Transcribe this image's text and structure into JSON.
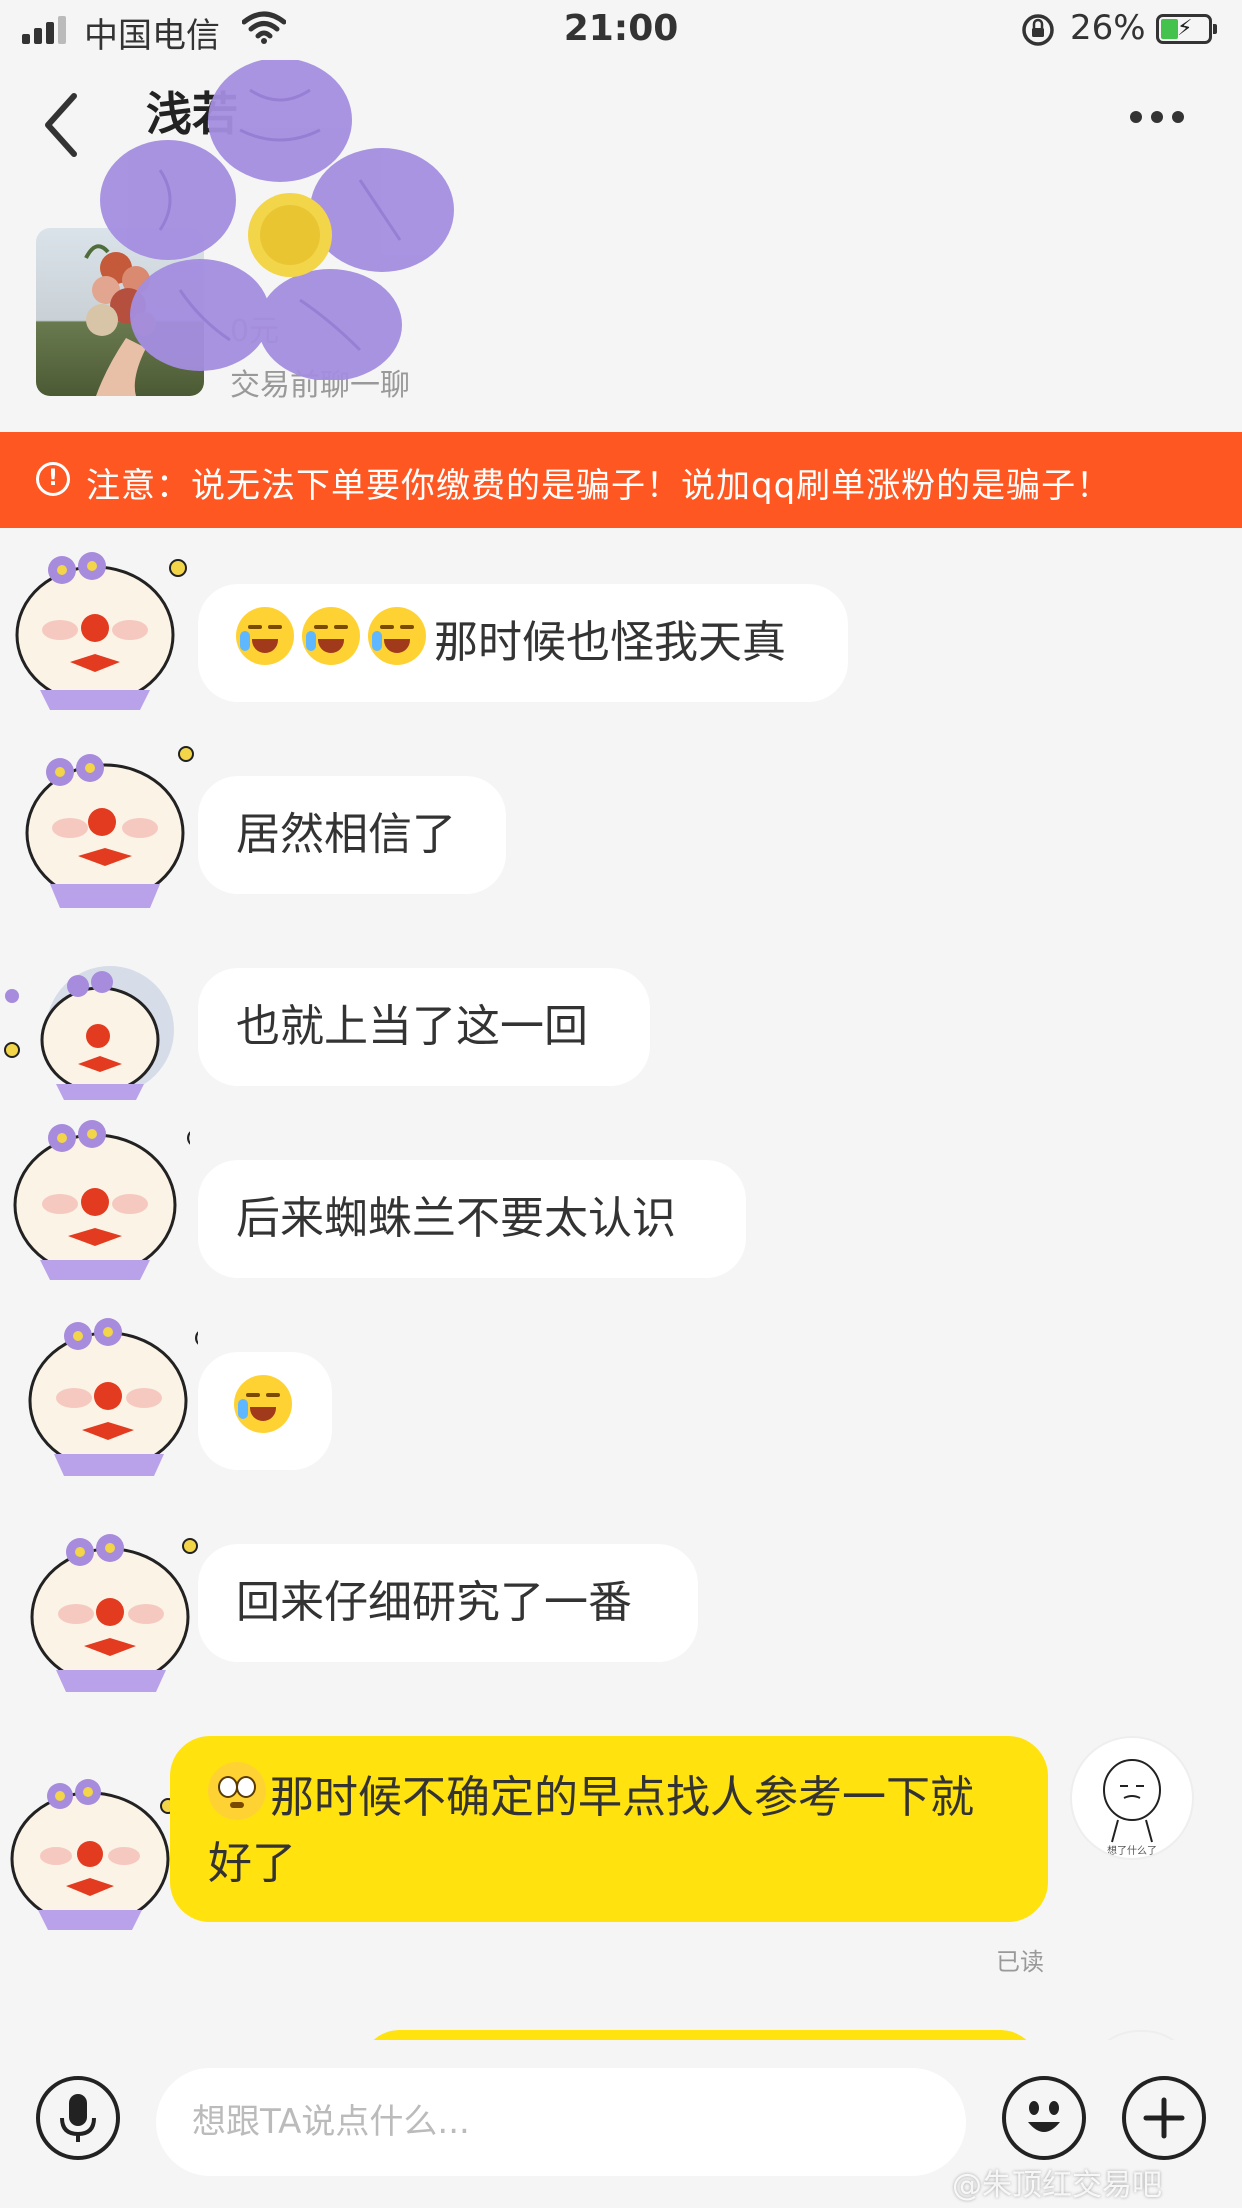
{
  "status_bar": {
    "carrier": "中国电信",
    "time": "21:00",
    "battery_percent": "26%",
    "battery_level": 0.26
  },
  "header": {
    "title": "浅若"
  },
  "item": {
    "price_fragment": "0元",
    "hint": "交易前聊一聊"
  },
  "warning": {
    "text": "注意：说无法下单要你缴费的是骗子！说加qq刷单涨粉的是骗子！",
    "color": "#ff5722"
  },
  "messages": [
    {
      "from": "other",
      "text": "那时候也怪我天真",
      "emoji": "loudly-crying-face",
      "emoji_count": 3
    },
    {
      "from": "other",
      "text": "居然相信了"
    },
    {
      "from": "other",
      "text": "也就上当了这一回"
    },
    {
      "from": "other",
      "text": "后来蜘蛛兰不要太认识"
    },
    {
      "from": "other",
      "text": "",
      "emoji": "loudly-crying-face",
      "emoji_count": 1
    },
    {
      "from": "other",
      "text": "回来仔细研究了一番"
    },
    {
      "from": "self",
      "text": "那时候不确定的早点找人参考一下就好了",
      "emoji": "pleading-face",
      "status": "已读"
    }
  ],
  "self_avatar_caption": "想了什么了",
  "input": {
    "placeholder": "想跟TA说点什么..."
  },
  "watermark": "@朱顶红交易吧",
  "colors": {
    "self_bubble": "#ffe20e",
    "other_bubble": "#ffffff",
    "background": "#f5f5f5"
  }
}
